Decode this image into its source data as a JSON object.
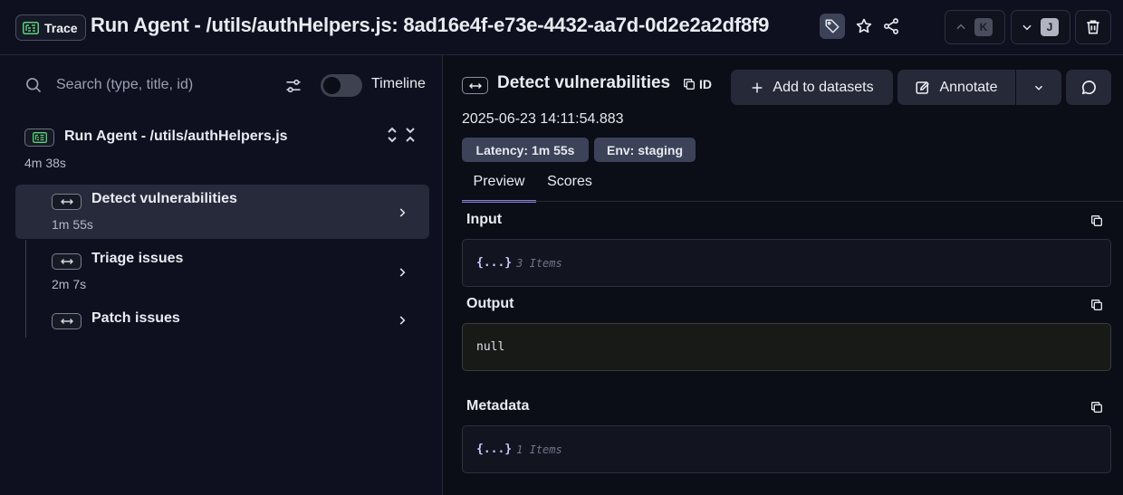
{
  "header": {
    "trace_chip_label": "Trace",
    "title": "Run Agent - /utils/authHelpers.js: 8ad16e4f-e73e-4432-aa7d-0d2e2a2df8f9",
    "prev_key": "K",
    "next_key": "J"
  },
  "left": {
    "search": {
      "placeholder": "Search (type, title, id)",
      "value": ""
    },
    "timeline_label": "Timeline",
    "root": {
      "title": "Run Agent - /utils/authHelpers.js",
      "duration": "4m 38s"
    },
    "spans": [
      {
        "name": "Detect vulnerabilities",
        "duration": "1m 55s",
        "selected": true
      },
      {
        "name": "Triage issues",
        "duration": "2m 7s",
        "selected": false
      },
      {
        "name": "Patch issues",
        "duration": "",
        "selected": false
      }
    ]
  },
  "right": {
    "title": "Detect vulnerabilities",
    "id_label": "ID",
    "add_to_datasets_label": "Add to datasets",
    "annotate_label": "Annotate",
    "timestamp": "2025-06-23 14:11:54.883",
    "badges": {
      "latency": "Latency: 1m 55s",
      "env": "Env: staging"
    },
    "tabs": [
      {
        "label": "Preview",
        "active": true
      },
      {
        "label": "Scores",
        "active": false
      }
    ],
    "input": {
      "label": "Input",
      "brace": "{...}",
      "count": "3 Items"
    },
    "output": {
      "label": "Output",
      "value": "null"
    },
    "metadata": {
      "label": "Metadata",
      "brace": "{...}",
      "count": "1 Items"
    }
  },
  "colors": {
    "background": "#0b0d17",
    "panel": "#0e1020",
    "accent": "#8a80d8",
    "badge": "#3c4258"
  },
  "icons": [
    "trace-icon",
    "tag-icon",
    "star-icon",
    "share-icon",
    "chevron-up-icon",
    "chevron-down-icon",
    "trash-icon",
    "search-icon",
    "sliders-icon",
    "span-icon",
    "chevron-right-icon",
    "copy-icon",
    "plus-icon",
    "edit-icon",
    "comment-icon"
  ]
}
